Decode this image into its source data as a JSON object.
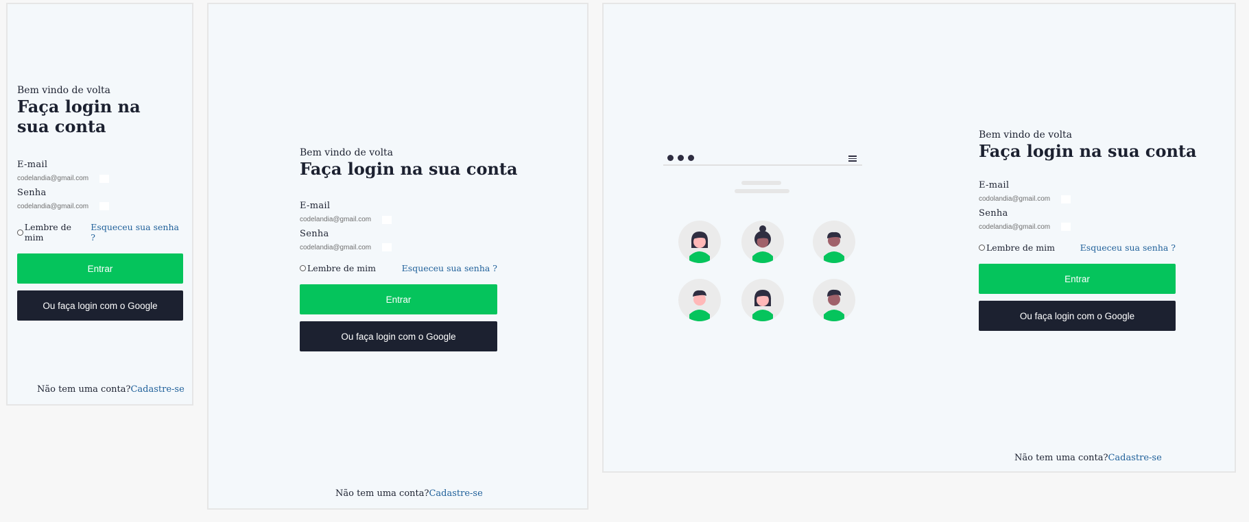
{
  "login": {
    "welcome": "Bem vindo de volta",
    "title": "Faça login na sua conta",
    "email_label": "E-mail",
    "password_label": "Senha",
    "mobile_email_value": "codelandia@gmail.com",
    "mobile_password_value": "codelandia@gmail.com",
    "tablet_email_value": "codelandia@gmail.com",
    "tablet_password_value": "codelandia@gmail.com",
    "desktop_email_value": "codolandia@gmail.com",
    "desktop_password_value": "codelandia@gmail.com",
    "remember_label": "Lembre de mim",
    "forgot_label": "Esqueceu sua senha ?",
    "submit_label": "Entrar",
    "google_label": "Ou faça login com o Google",
    "signup_prompt": "Não tem uma conta?",
    "signup_link": "Cadastre-se"
  },
  "illustration": {
    "icons": [
      "dot-icon",
      "dot-icon",
      "dot-icon",
      "hamburger-icon"
    ],
    "avatars": [
      "woman-avatar",
      "woman-bun-avatar",
      "man-avatar",
      "man-avatar",
      "woman-avatar",
      "man-avatar"
    ]
  },
  "colors": {
    "primary": "#05c45c",
    "dark": "#1c2130",
    "link": "#1e5f99",
    "background": "#f4f8fb"
  }
}
